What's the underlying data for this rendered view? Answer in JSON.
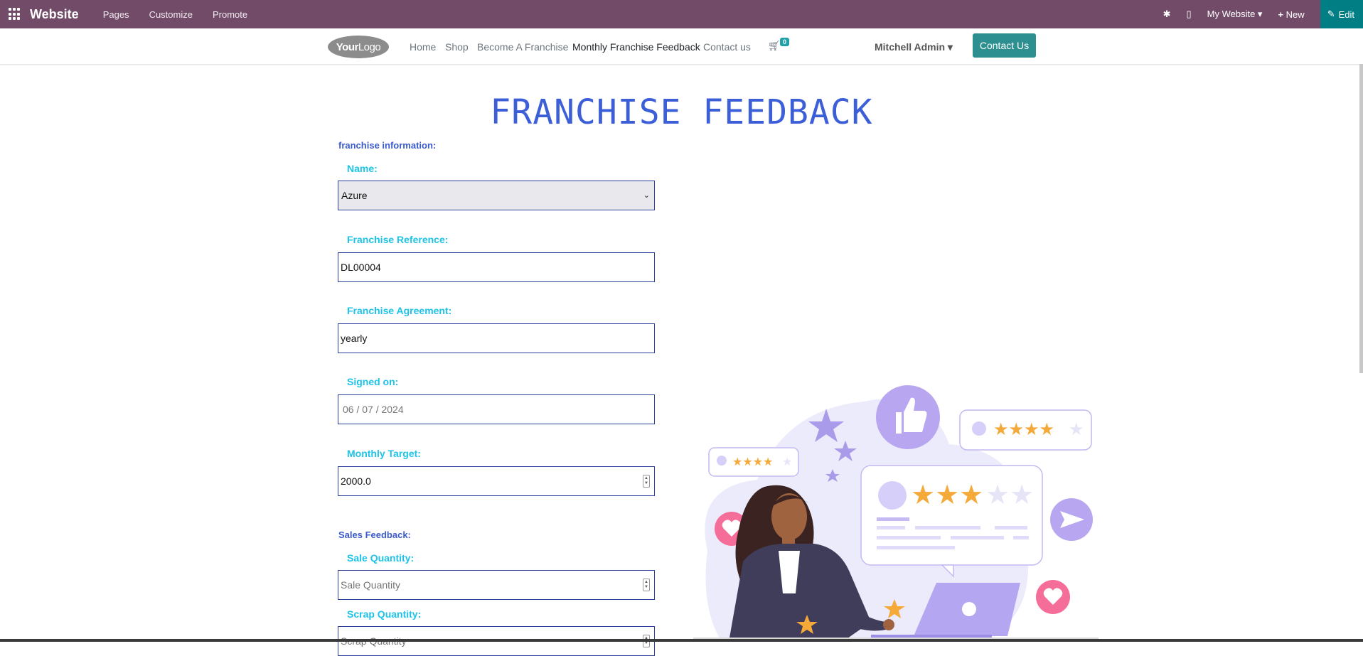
{
  "topbar": {
    "brand": "Website",
    "menu": [
      "Pages",
      "Customize",
      "Promote"
    ],
    "my_website": "My Website",
    "new_label": "New",
    "edit_label": "Edit"
  },
  "header": {
    "logo_bold": "Your",
    "logo_light": "Logo",
    "nav": [
      "Home",
      "Shop",
      "Become A Franchise",
      "Monthly Franchise Feedback",
      "Contact us"
    ],
    "cart_count": "0",
    "user": "Mitchell Admin",
    "contact_button": "Contact Us"
  },
  "page": {
    "title": "FRANCHISE FEEDBACK",
    "section_info": "franchise information:",
    "section_sales": "Sales Feedback:",
    "fields": {
      "name_label": "Name:",
      "name_value": "Azure",
      "ref_label": "Franchise Reference:",
      "ref_value": "DL00004",
      "agreement_label": "Franchise Agreement:",
      "agreement_value": "yearly",
      "signed_label": "Signed on:",
      "signed_value": "06 / 07 / 2024",
      "target_label": "Monthly Target:",
      "target_value": "2000.0",
      "sale_qty_label": "Sale Quantity:",
      "sale_qty_placeholder": "Sale Quantity",
      "scrap_qty_label": "Scrap Quantity:",
      "scrap_qty_placeholder": "Scrap Quantity"
    }
  },
  "colors": {
    "admin_bar": "#714b67",
    "edit_button": "#017e84",
    "title": "#3c5fd8",
    "label": "#1ec3e8",
    "contact_button": "#2d8f8f"
  }
}
